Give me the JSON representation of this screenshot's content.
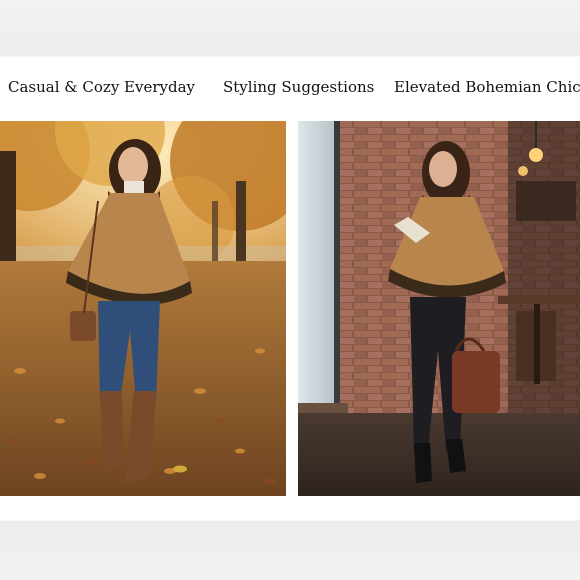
{
  "captions": {
    "left": "Casual & Cozy Everyday",
    "middle": "Styling Suggestions",
    "right": "Elevated Bohemian Chic"
  },
  "photos": {
    "left": {
      "subject": "woman-autumn-park-poncho",
      "palette": {
        "leaves": "#c88a3a",
        "poncho": "#b8864c",
        "jeans": "#2f4f7a",
        "boots": "#7a4a2a"
      }
    },
    "right": {
      "subject": "woman-cafe-window-poncho",
      "palette": {
        "brick": "#8a5a48",
        "poncho": "#b8864c",
        "leggings": "#1e1e22",
        "bag": "#7a3a26"
      }
    }
  }
}
